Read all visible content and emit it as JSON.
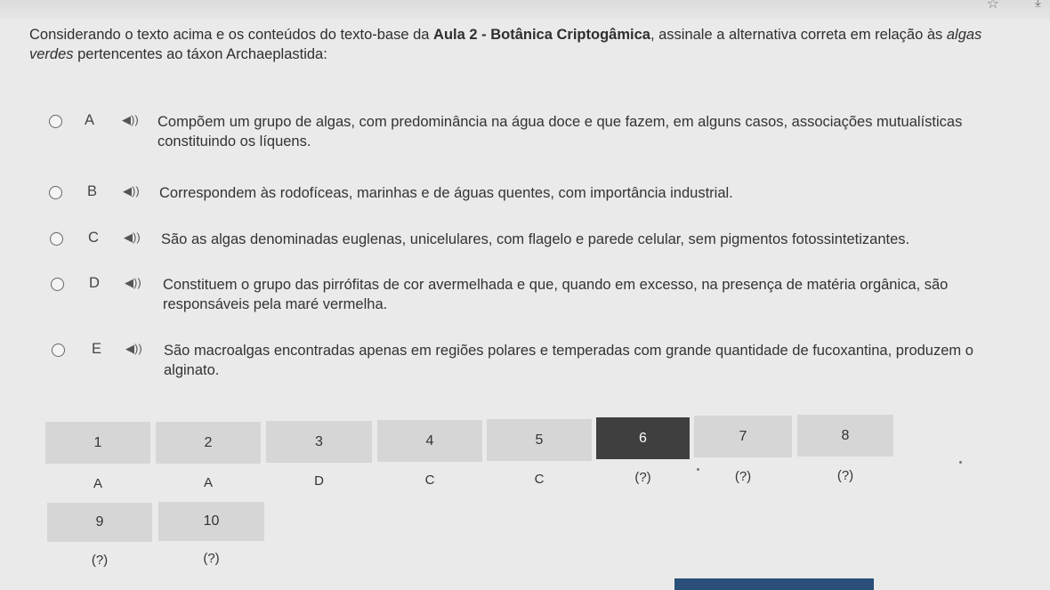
{
  "question": {
    "prefix": "Considerando o texto acima e os conteúdos do texto-base da ",
    "bold": "Aula 2 - Botânica Criptogâmica",
    "middle": ", assinale a alternativa correta em relação às ",
    "italic_a": "algas",
    "italic_b": "verdes",
    "suffix": " pertencentes ao táxon Archaeplastida:"
  },
  "options": [
    {
      "letter": "A",
      "line1": "Compõem um grupo de algas, com predominância na água doce e que fazem, em alguns casos, associações mutualísticas",
      "line2": "constituindo os líquens."
    },
    {
      "letter": "B",
      "line1": "Correspondem às rodofíceas, marinhas e de águas quentes, com importância industrial.",
      "line2": ""
    },
    {
      "letter": "C",
      "line1": "São as algas denominadas euglenas, unicelulares, com flagelo e parede celular, sem pigmentos fotossintetizantes.",
      "line2": ""
    },
    {
      "letter": "D",
      "line1": "Constituem o grupo das pirrófitas de cor avermelhada e que, quando em excesso, na presença de matéria orgânica, são",
      "line2": "responsáveis pela maré vermelha."
    },
    {
      "letter": "E",
      "line1": "São macroalgas encontradas apenas em regiões polares e temperadas com grande quantidade de fucoxantina, produzem o",
      "line2": "alginato."
    }
  ],
  "speaker_icon": "speaker-icon",
  "question_nav": {
    "row1": [
      {
        "number": "1",
        "answer": "A"
      },
      {
        "number": "2",
        "answer": "A"
      },
      {
        "number": "3",
        "answer": "D"
      },
      {
        "number": "4",
        "answer": "C"
      },
      {
        "number": "5",
        "answer": "C"
      },
      {
        "number": "6",
        "answer": "(?)"
      },
      {
        "number": "7",
        "answer": "(?)"
      },
      {
        "number": "8",
        "answer": "(?)"
      }
    ],
    "row2": [
      {
        "number": "9",
        "answer": "(?)"
      },
      {
        "number": "10",
        "answer": "(?)"
      }
    ],
    "active_number": "6"
  },
  "colors": {
    "background": "#eaeaea",
    "cell": "#d6d6d6",
    "active_cell": "#3f3f3f",
    "bottom_button": "#2a4f78"
  }
}
